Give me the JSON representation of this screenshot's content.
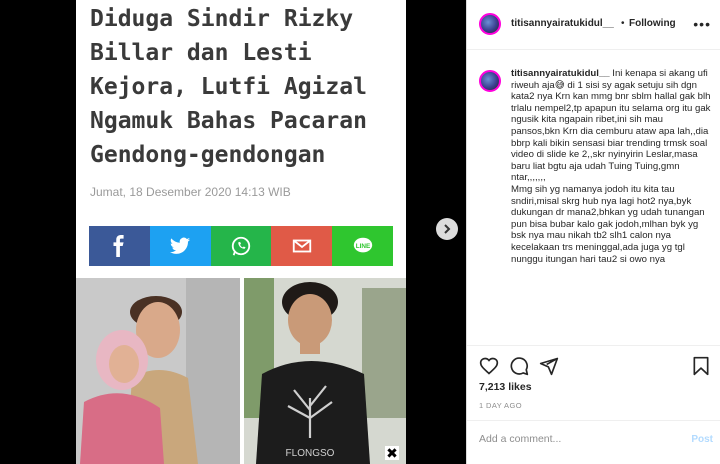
{
  "article": {
    "headline": "Diduga Sindir Rizky Billar dan Lesti Kejora, Lutfi Agizal Ngamuk Bahas Pacaran Gendong-gendongan",
    "date": "Jumat, 18 Desember 2020 14:13 WIB",
    "share_buttons": [
      {
        "icon": "facebook-icon",
        "color": "#3b5998"
      },
      {
        "icon": "twitter-icon",
        "color": "#1da1f2"
      },
      {
        "icon": "whatsapp-icon",
        "color": "#25b54a"
      },
      {
        "icon": "email-icon",
        "color": "#e05a47"
      },
      {
        "icon": "line-icon",
        "color": "#2fc62f"
      }
    ],
    "shirt_text": "FLONGSO"
  },
  "post": {
    "username": "titisannyairatukidul__",
    "separator": "•",
    "follow_label": "Following",
    "more_icon": "•••",
    "caption_user": "titisannyairatukidul__",
    "caption_text": " Ini kenapa si akang ufi riweuh aja😅 di 1 sisi sy agak setuju sih dgn kata2 nya Krn kan mmg bnr sblm hallal gak blh trlalu nempel2,tp apapun itu selama org itu gak ngusik kita ngapain ribet,ini sih mau pansos,bkn Krn dia cemburu ataw apa lah,,dia bbrp kali bikin sensasi biar trending trmsk soal video di slide ke 2,,skr nyinyirin Leslar,masa baru liat bgtu aja udah Tuing Tuing,gmn ntar,,,,,,,",
    "caption_text2": "Mmg sih yg namanya jodoh itu kita tau sndiri,misal skrg hub nya lagi hot2 nya,byk dukungan dr mana2,bhkan yg udah tunangan pun bisa bubar kalo gak jodoh,mlhan byk yg bsk nya mau nikah tb2 slh1 calon nya kecelakaan trs meninggal,ada juga yg tgl nunggu itungan hari tau2 si owo nya",
    "likes": "7,213 likes",
    "date": "1 DAY AGO",
    "comment_placeholder": "Add a comment...",
    "post_label": "Post",
    "close_label": "✖"
  }
}
